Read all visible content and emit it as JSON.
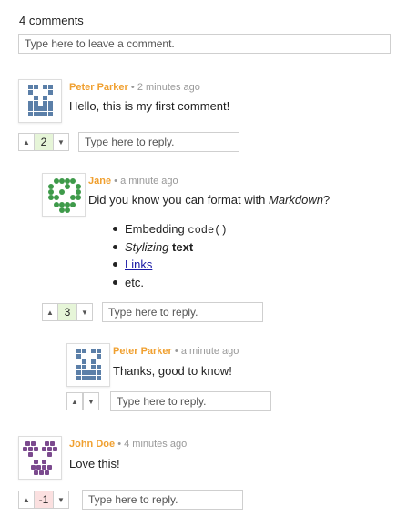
{
  "header": {
    "count_label": "4 comments"
  },
  "new_comment": {
    "placeholder": "Type here to leave a comment."
  },
  "comments": [
    {
      "author": "Peter Parker",
      "separator": "•",
      "time": "2 minutes ago",
      "text": "Hello, this is my first comment!",
      "score": "2",
      "reply_placeholder": "Type here to reply.",
      "avatar_color": "#5b7fa8"
    },
    {
      "author": "Jane",
      "separator": "•",
      "time": "a minute ago",
      "text_prefix": "Did you know you can format with ",
      "text_emph": "Markdown",
      "text_suffix": "?",
      "list": {
        "item1_text": "Embedding ",
        "item1_code": "code()",
        "item2_emph": "Stylizing",
        "item2_space": " ",
        "item2_strong": "text",
        "item3_link": "Links",
        "item4_text": "etc."
      },
      "score": "3",
      "reply_placeholder": "Type here to reply.",
      "avatar_color": "#3e9a4a"
    },
    {
      "author": "Peter Parker",
      "separator": "•",
      "time": "a minute ago",
      "text": "Thanks, good to know!",
      "reply_placeholder": "Type here to reply.",
      "avatar_color": "#5b7fa8"
    },
    {
      "author": "John Doe",
      "separator": "•",
      "time": "4 minutes ago",
      "text": "Love this!",
      "score": "-1",
      "reply_placeholder": "Type here to reply.",
      "avatar_color": "#7b4a8e"
    }
  ],
  "vote": {
    "up_glyph": "▲",
    "down_glyph": "▼"
  },
  "colors": {
    "author": "#f0a030",
    "positive_score_bg": "#e6f5d8",
    "negative_score_bg": "#fbe0e0",
    "link": "#1a1aa6"
  }
}
